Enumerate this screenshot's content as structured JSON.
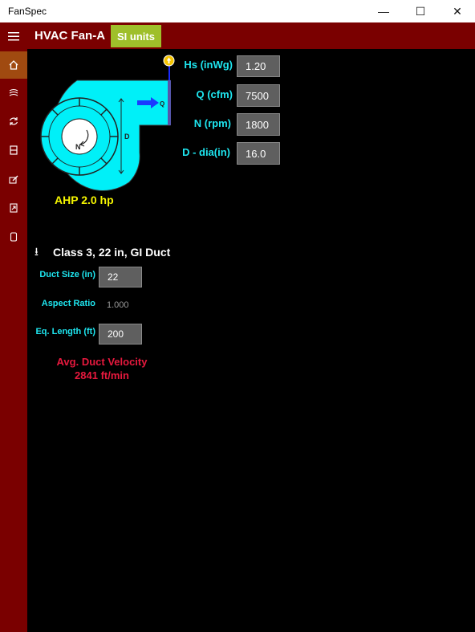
{
  "window": {
    "title": "FanSpec"
  },
  "header": {
    "title": "HVAC Fan-A",
    "units_button": "SI units"
  },
  "nav": {
    "items": [
      {
        "icon": "home-icon"
      },
      {
        "icon": "fan-curve-icon"
      },
      {
        "icon": "refresh-icon"
      },
      {
        "icon": "layout-icon"
      },
      {
        "icon": "edit-icon"
      },
      {
        "icon": "export-icon"
      },
      {
        "icon": "page-icon"
      }
    ]
  },
  "fan": {
    "hs_label": "Hs (inWg)",
    "hs_value": "1.20",
    "q_label": "Q (cfm)",
    "q_value": "7500",
    "n_label": "N (rpm)",
    "n_value": "1800",
    "d_label": "D - dia(in)",
    "d_value": "16.0",
    "ahp": "AHP 2.0 hp",
    "diagram_q": "Q",
    "diagram_d": "D",
    "diagram_n": "N"
  },
  "duct": {
    "title": "Class 3, 22 in, GI Duct",
    "size_label": "Duct Size (in)",
    "size_value": "22",
    "aspect_label": "Aspect Ratio",
    "aspect_value": "1.000",
    "length_label": "Eq. Length (ft)",
    "length_value": "200",
    "velocity_label": "Avg. Duct Velocity",
    "velocity_value": "2841 ft/min"
  },
  "colors": {
    "nav_bg": "#7a0000",
    "accent": "#9fbf2a",
    "cyan": "#1ee6f0",
    "yellow": "#f5f500",
    "red": "#e8193e"
  }
}
